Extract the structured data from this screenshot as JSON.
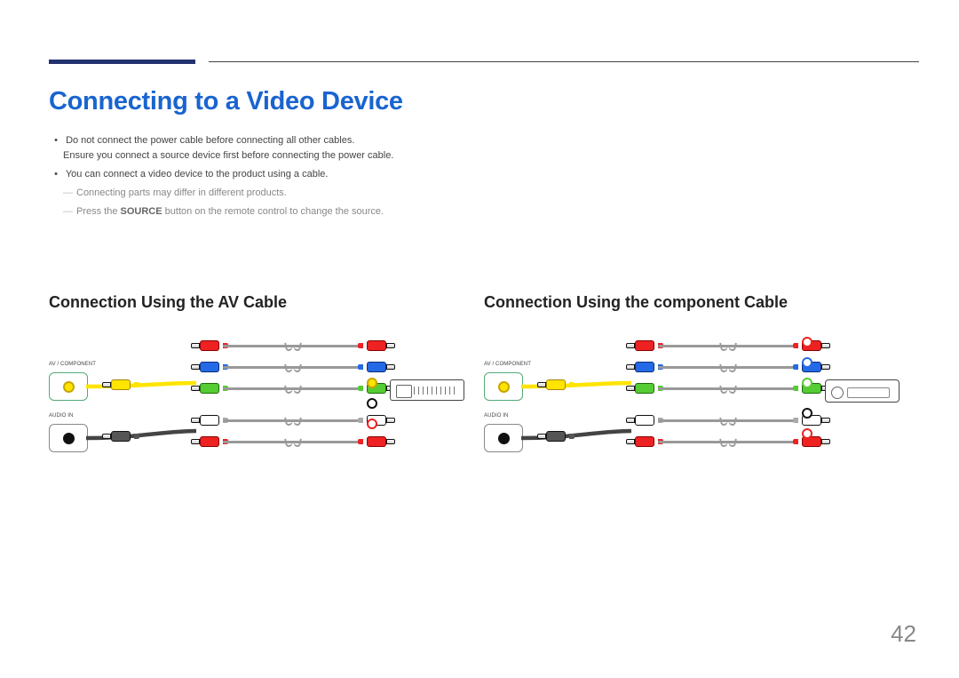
{
  "title": "Connecting to a Video Device",
  "intro": {
    "bullets": [
      {
        "line1": "Do not connect the power cable before connecting all other cables.",
        "line2": "Ensure you connect a source device first before connecting the power cable."
      },
      {
        "line1": "You can connect a video device to the product using a cable."
      }
    ],
    "notes": [
      "Connecting parts may differ in different products.",
      "Press the SOURCE button on the remote control to change the source."
    ],
    "strong_word": "SOURCE"
  },
  "left": {
    "heading": "Connection Using the AV Cable",
    "port_labels": {
      "av": "AV / COMPONENT",
      "audio": "AUDIO IN"
    },
    "rows": [
      "red",
      "blue",
      "green",
      "white",
      "red"
    ],
    "dest": [
      "yellow",
      "white",
      "red"
    ]
  },
  "right": {
    "heading": "Connection Using the component Cable",
    "port_labels": {
      "av": "AV / COMPONENT",
      "audio": "AUDIO IN"
    },
    "rows": [
      "red",
      "blue",
      "green",
      "white",
      "red"
    ],
    "dest": [
      "red",
      "blue",
      "green",
      "white",
      "red"
    ]
  },
  "page_number": "42"
}
